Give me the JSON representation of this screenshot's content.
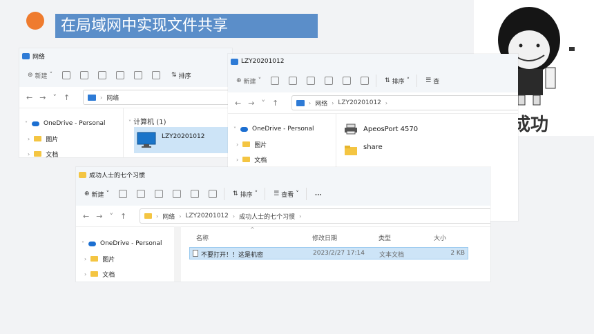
{
  "slide": {
    "title": "在局域网中实现文件共享",
    "meme_caption": "成功"
  },
  "colors": {
    "accent": "#ef7b2e",
    "title_bg": "#5b8ec9",
    "selection": "#cde4f7"
  },
  "win1": {
    "title": "网络",
    "cmd": {
      "new": "新建",
      "sort": "排序"
    },
    "path": [
      "网络"
    ],
    "sidebar": [
      "OneDrive - Personal",
      "图片",
      "文档"
    ],
    "group": "计算机 (1)",
    "item": "LZY20201012"
  },
  "win2": {
    "title": "LZY20201012",
    "cmd": {
      "new": "新建",
      "sort": "排序",
      "view": "查"
    },
    "path": [
      "网络",
      "LZY20201012"
    ],
    "sidebar": [
      "OneDrive - Personal",
      "图片",
      "文档"
    ],
    "items": [
      "ApeosPort 4570",
      "share"
    ]
  },
  "win3": {
    "title": "成功人士的七个习惯",
    "cmd": {
      "new": "新建",
      "sort": "排序",
      "view": "查看",
      "more": "..."
    },
    "path": [
      "网络",
      "LZY20201012",
      "成功人士的七个习惯"
    ],
    "sidebar": [
      "OneDrive - Personal",
      "图片",
      "文档"
    ],
    "columns": [
      "名称",
      "修改日期",
      "类型",
      "大小"
    ],
    "file": {
      "name": "不要打开！！这是机密",
      "date": "2023/2/27 17:14",
      "type": "文本文档",
      "size": "2 KB"
    }
  }
}
